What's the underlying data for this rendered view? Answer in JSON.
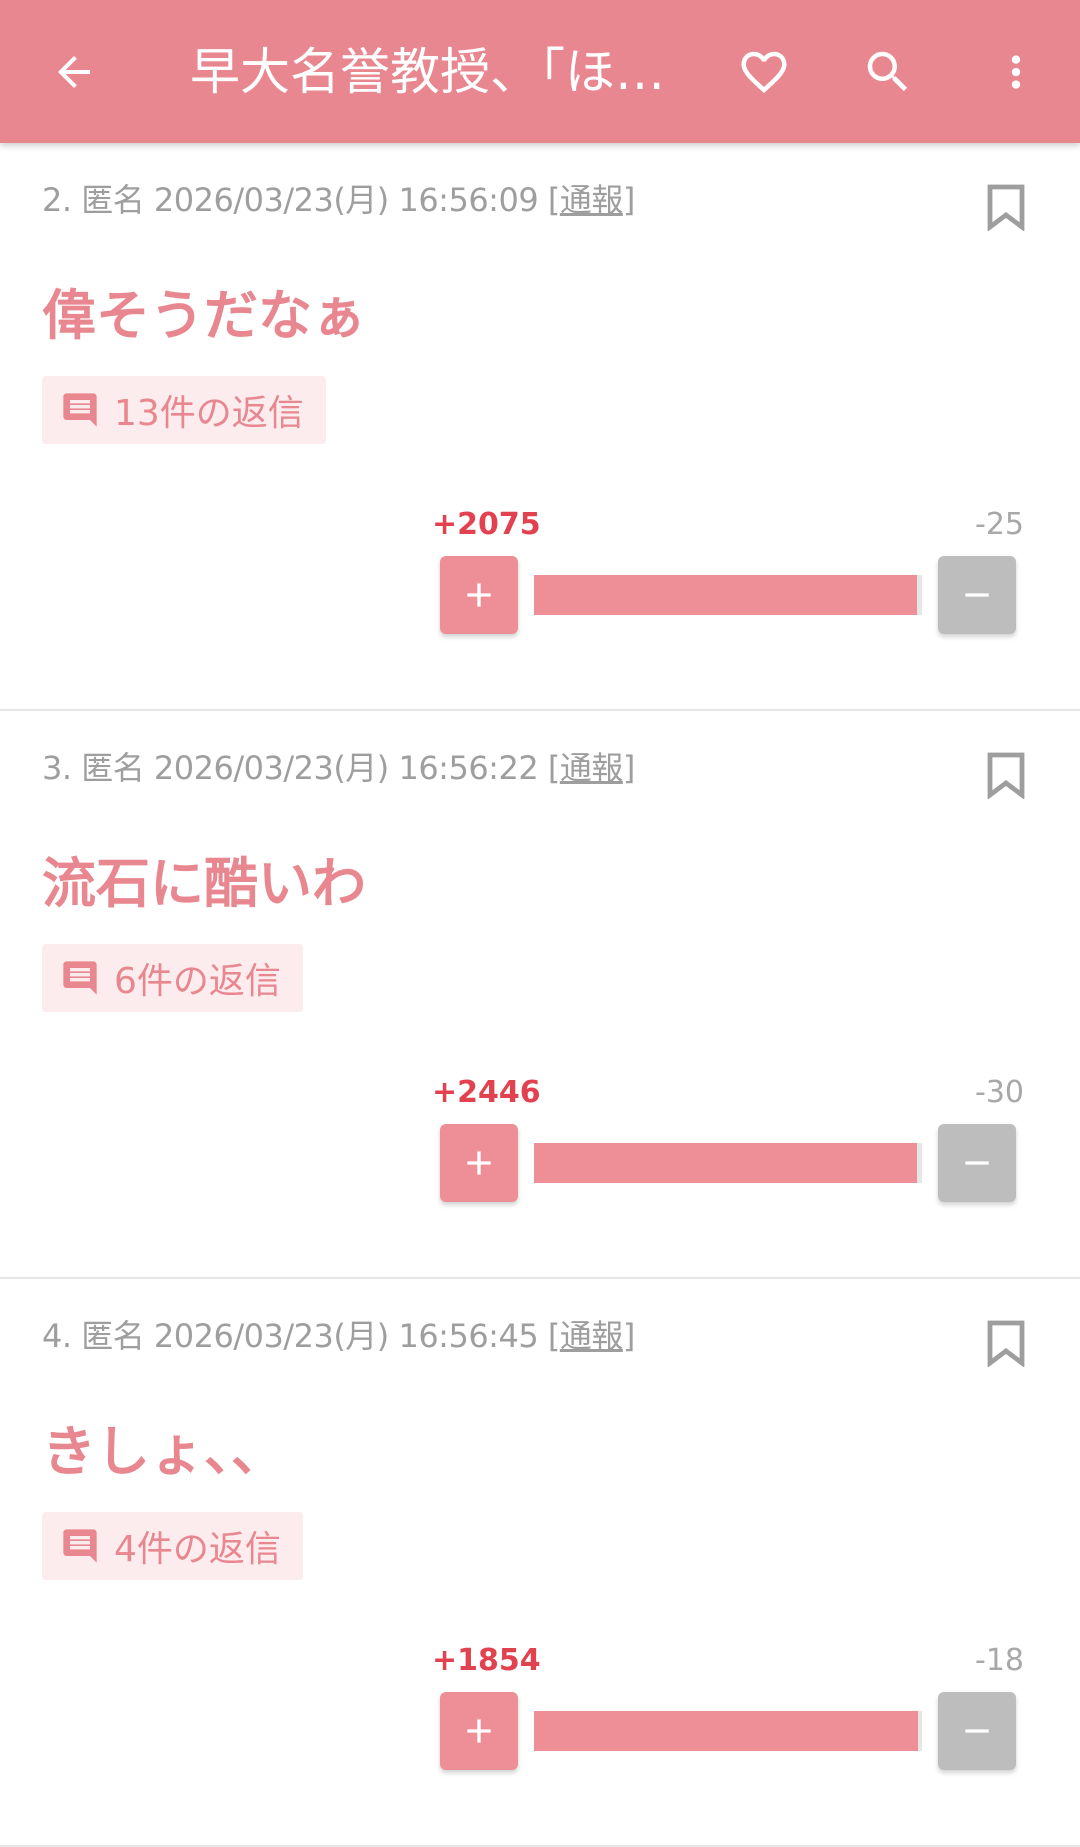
{
  "appbar": {
    "title": "早大名誉教授、「ほ…",
    "icons": [
      "back-arrow-icon",
      "heart-icon",
      "search-icon",
      "more-vertical-icon"
    ],
    "color": "#e8878f"
  },
  "posts": [
    {
      "meta": "2. 匿名 2026/03/23(月) 16:56:09 ",
      "report": "通報",
      "body": "偉そうだなぁ",
      "reply_label": "13件の返信",
      "plus": "+2075",
      "minus": "-25",
      "plus_value": 2075,
      "minus_value": 25
    },
    {
      "meta": "3. 匿名 2026/03/23(月) 16:56:22 ",
      "report": "通報",
      "body": "流石に酷いわ",
      "reply_label": "6件の返信",
      "plus": "+2446",
      "minus": "-30",
      "plus_value": 2446,
      "minus_value": 30
    },
    {
      "meta": "4. 匿名 2026/03/23(月) 16:56:45 ",
      "report": "通報",
      "body": "きしょ、、",
      "reply_label": "4件の返信",
      "plus": "+1854",
      "minus": "-18",
      "plus_value": 1854,
      "minus_value": 18
    }
  ],
  "colors": {
    "accent": "#e8878f",
    "plus_text": "#e2414f",
    "bar_fill": "#ee8f98",
    "minus_button": "#bdbdbd"
  }
}
